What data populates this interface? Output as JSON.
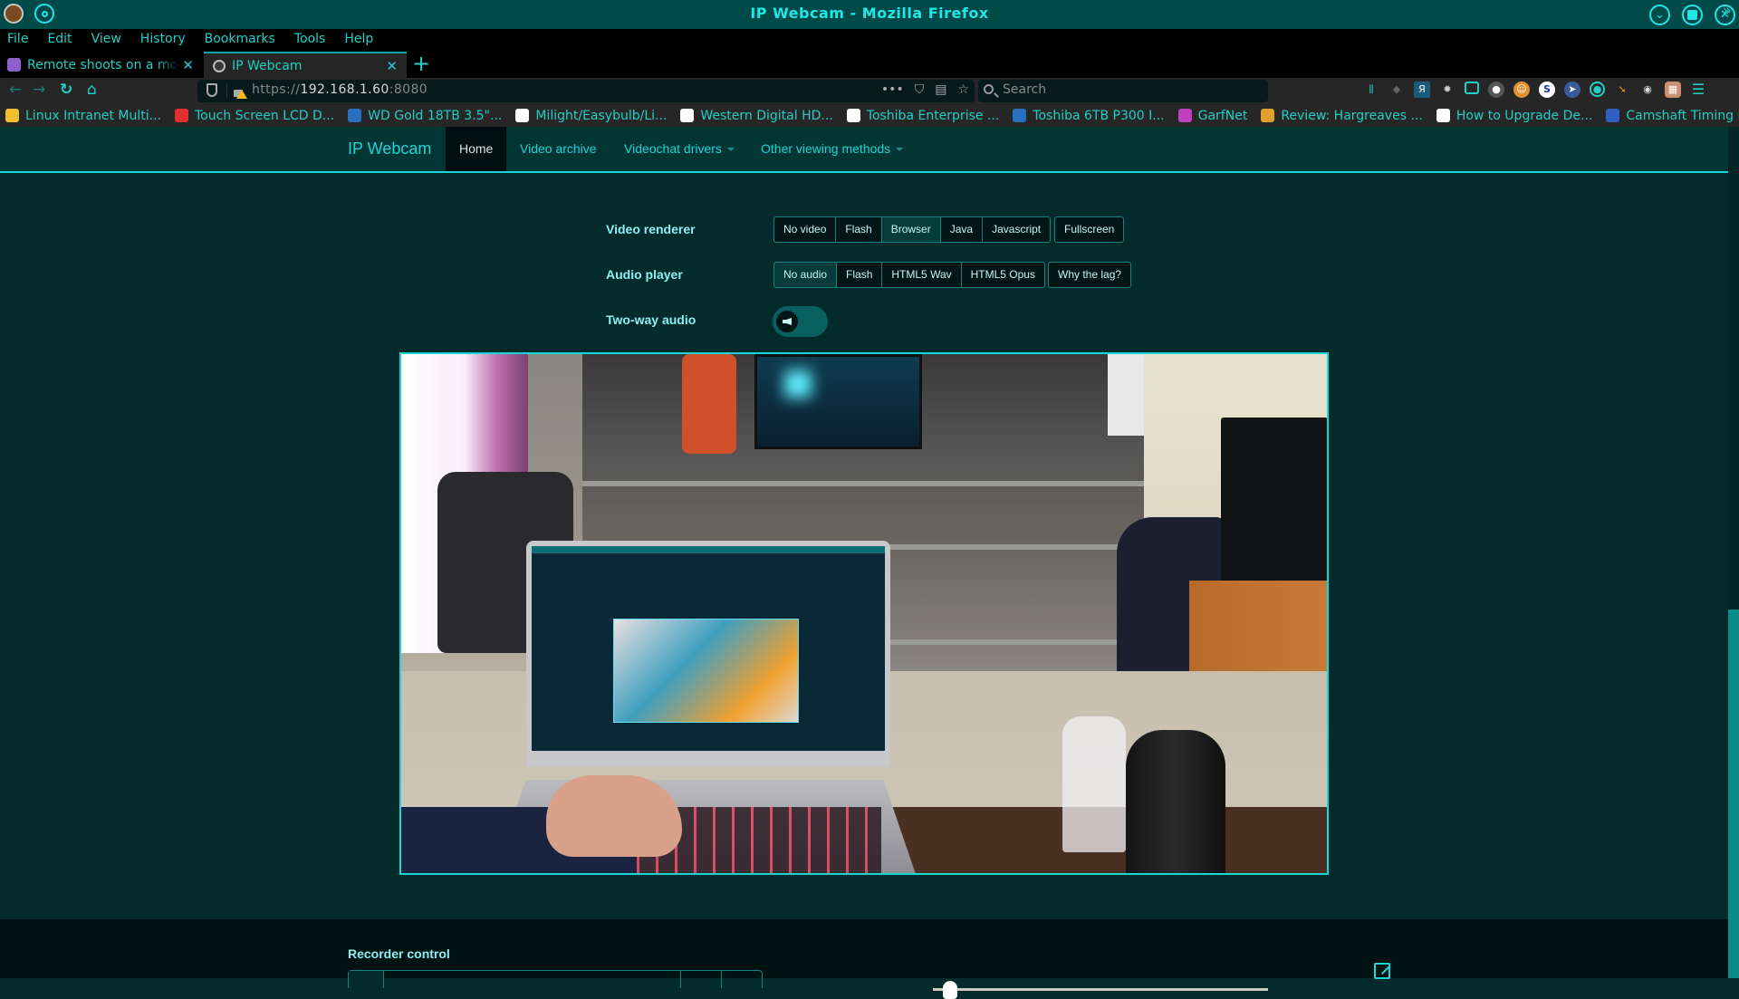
{
  "window": {
    "title": "IP Webcam - Mozilla Firefox"
  },
  "menu": [
    "File",
    "Edit",
    "View",
    "History",
    "Bookmarks",
    "Tools",
    "Help"
  ],
  "tabs": [
    {
      "label": "Remote shoots on a mobile",
      "active": false
    },
    {
      "label": "IP Webcam",
      "active": true
    }
  ],
  "new_tab_label": "+",
  "toolbar": {
    "url_scheme": "https://",
    "url_host": "192.168.1.60",
    "url_port": ":8080",
    "search_placeholder": "Search",
    "page_action_more": "•••"
  },
  "bookmarks": [
    {
      "label": "Linux Intranet Multi...",
      "icon_color": "#f0c030"
    },
    {
      "label": "Touch Screen LCD D...",
      "icon_color": "#e03030"
    },
    {
      "label": "WD Gold 18TB 3.5\"...",
      "icon_color": "#2a70c0"
    },
    {
      "label": "Milight/Easybulb/Li...",
      "icon_color": "#ffffff"
    },
    {
      "label": "Western Digital HD...",
      "icon_color": "#ffffff"
    },
    {
      "label": "Toshiba Enterprise ...",
      "icon_color": "#ffffff"
    },
    {
      "label": "Toshiba 6TB P300 I...",
      "icon_color": "#2a70c0"
    },
    {
      "label": "GarfNet",
      "icon_color": "#c040c0"
    },
    {
      "label": "Review: Hargreaves ...",
      "icon_color": "#e0a030"
    },
    {
      "label": "How to Upgrade De...",
      "icon_color": "#ffffff"
    },
    {
      "label": "Camshaft Timing Bel...",
      "icon_color": "#3060c0"
    }
  ],
  "bookmarks_overflow": "»",
  "site": {
    "brand": "IP Webcam",
    "nav": [
      {
        "label": "Home",
        "active": true,
        "dropdown": false
      },
      {
        "label": "Video archive",
        "active": false,
        "dropdown": false
      },
      {
        "label": "Videochat drivers",
        "active": false,
        "dropdown": true
      },
      {
        "label": "Other viewing methods",
        "active": false,
        "dropdown": true
      }
    ]
  },
  "controls": {
    "video_renderer": {
      "label": "Video renderer",
      "options": [
        "No video",
        "Flash",
        "Browser",
        "Java",
        "Javascript"
      ],
      "selected": "Browser",
      "extra": "Fullscreen"
    },
    "audio_player": {
      "label": "Audio player",
      "options": [
        "No audio",
        "Flash",
        "HTML5 Wav",
        "HTML5 Opus"
      ],
      "selected": "No audio",
      "extra": "Why the lag?"
    },
    "two_way_audio": {
      "label": "Two-way audio",
      "enabled": false
    }
  },
  "video": {
    "description": "Live webcam feed of a room with a laptop on a desk"
  },
  "recorder": {
    "label": "Recorder control",
    "slider_value_percent": 5
  },
  "colors": {
    "accent": "#1bd6d6",
    "titlebar": "#014a4a",
    "page_bg": "#032b2c",
    "button_border": "#148282"
  }
}
